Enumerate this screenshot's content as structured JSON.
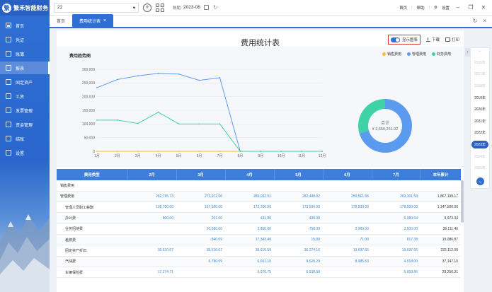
{
  "app": {
    "logo_text": "繁禾智能财务",
    "logo_mark": "繁"
  },
  "sidebar": {
    "items": [
      {
        "label": "首页",
        "icon": "home-icon"
      },
      {
        "label": "凭证",
        "icon": "voucher-icon"
      },
      {
        "label": "账簿",
        "icon": "ledger-icon"
      },
      {
        "label": "报表",
        "icon": "report-icon",
        "active": true
      },
      {
        "label": "固定资产",
        "icon": "asset-icon"
      },
      {
        "label": "工资",
        "icon": "salary-icon"
      },
      {
        "label": "发票管理",
        "icon": "invoice-icon"
      },
      {
        "label": "资金管理",
        "icon": "fund-icon"
      },
      {
        "label": "结账",
        "icon": "close-books-icon"
      },
      {
        "label": "设置",
        "icon": "settings-icon"
      }
    ]
  },
  "topbar": {
    "company": "22",
    "period_label": "账期",
    "period_value": "2023-08",
    "links": [
      "首页",
      "帮助",
      "设置"
    ]
  },
  "tabs": {
    "items": [
      {
        "label": "首页"
      },
      {
        "label": "费用统计表",
        "active": true
      }
    ]
  },
  "report": {
    "title": "费用统计表",
    "toggle_label": "显示图表",
    "download_label": "下载",
    "print_label": "打印",
    "chart_title": "费用趋势图"
  },
  "colors": {
    "sales": "#f2c12e",
    "admin": "#5b9bef",
    "finance": "#3fd1a8",
    "accent": "#2f6fd3"
  },
  "chart_data": [
    {
      "type": "line",
      "x": [
        "1月",
        "2月",
        "3月",
        "4月",
        "5月",
        "6月",
        "7月",
        "8月",
        "9月",
        "10月",
        "11月",
        "12月"
      ],
      "ylim": [
        0,
        300000
      ],
      "yticks": [
        "0",
        "50,000",
        "100,000",
        "150,000",
        "200,000",
        "250,000",
        "300,000"
      ],
      "grid": true,
      "legend_position": "top-right",
      "series": [
        {
          "name": "销售费用",
          "color": "#f2c12e",
          "values": [
            0,
            0,
            0,
            0,
            0,
            0,
            0,
            0,
            0,
            0,
            0,
            0
          ]
        },
        {
          "name": "管理费用",
          "color": "#5b9bef",
          "values": [
            233000,
            262700,
            276000,
            285000,
            282400,
            259500,
            269300,
            0,
            0,
            0,
            0,
            0
          ]
        },
        {
          "name": "财务费用",
          "color": "#3fd1a8",
          "values": [
            114000,
            114000,
            102000,
            143000,
            100000,
            100000,
            100000,
            0,
            0,
            0,
            0,
            0
          ]
        }
      ]
    },
    {
      "type": "pie",
      "center_label": "合计",
      "center_value": "¥ 2,650,251.02",
      "slices": [
        {
          "name": "销售费用",
          "color": "#f2c12e",
          "value": 0
        },
        {
          "name": "管理费用",
          "color": "#5b9bef",
          "value": 1867199.17
        },
        {
          "name": "财务费用",
          "color": "#3fd1a8",
          "value": 783051.85
        }
      ]
    }
  ],
  "table": {
    "headers": [
      "费用类型",
      "2月",
      "3月",
      "4月",
      "5月",
      "6月",
      "7月",
      "本年累计"
    ],
    "rows": [
      {
        "name": "销售费用",
        "sub": false,
        "cells": [
          "",
          "",
          "",
          "",
          "",
          ""
        ],
        "total": ""
      },
      {
        "name": "管理费用",
        "sub": false,
        "cells": [
          "262,795.73",
          "275,972.66",
          "285,032.51",
          "282,449.92",
          "259,561.96",
          "269,301.58"
        ],
        "total": "1,867,199.17"
      },
      {
        "name": "管理人员职工薪酬",
        "sub": true,
        "cells": [
          "138,700.00",
          "167,500.00",
          "172,700.00",
          "173,500.00",
          "178,500.00",
          "178,500.00"
        ],
        "total": "1,147,500.00"
      },
      {
        "name": "办公费",
        "sub": true,
        "cells": [
          "800.00",
          "201.00",
          "431.80",
          "400.00",
          "",
          "6,080.54"
        ],
        "total": "9,973.34"
      },
      {
        "name": "业务招待费",
        "sub": true,
        "cells": [
          "",
          "20,580.00",
          "3,860.00",
          "-790.00",
          "2,960.00",
          "3,500.00"
        ],
        "total": "39,111.40"
      },
      {
        "name": "差旅费",
        "sub": true,
        "cells": [
          "",
          "840.09",
          "17,343.40",
          "15.00",
          "71.00",
          "817.38"
        ],
        "total": "19,086.87"
      },
      {
        "name": "固定资产折旧",
        "sub": true,
        "cells": [
          "36,610.67",
          "36,610.67",
          "36,610.59",
          "36,274.16",
          "19,697.66",
          "19,697.66"
        ],
        "total": "222,112.09"
      },
      {
        "name": "汽油费",
        "sub": true,
        "cells": [
          "",
          "6,780.09",
          "6,661.10",
          "9,520.29",
          "8,985.53",
          "4,018.00"
        ],
        "total": "37,147.10"
      },
      {
        "name": "车辆保险费",
        "sub": true,
        "cells": [
          "17,274.71",
          "",
          "3,070.75",
          "6,530.58",
          "",
          "5,053.86"
        ],
        "total": "29,256.31"
      }
    ]
  },
  "years": {
    "items": [
      "2016年",
      "2017年",
      "2018年",
      "2019年",
      "2020年",
      "2021年",
      "2022年",
      "2023年",
      "2024年",
      "2025年"
    ],
    "active": "2023年"
  }
}
